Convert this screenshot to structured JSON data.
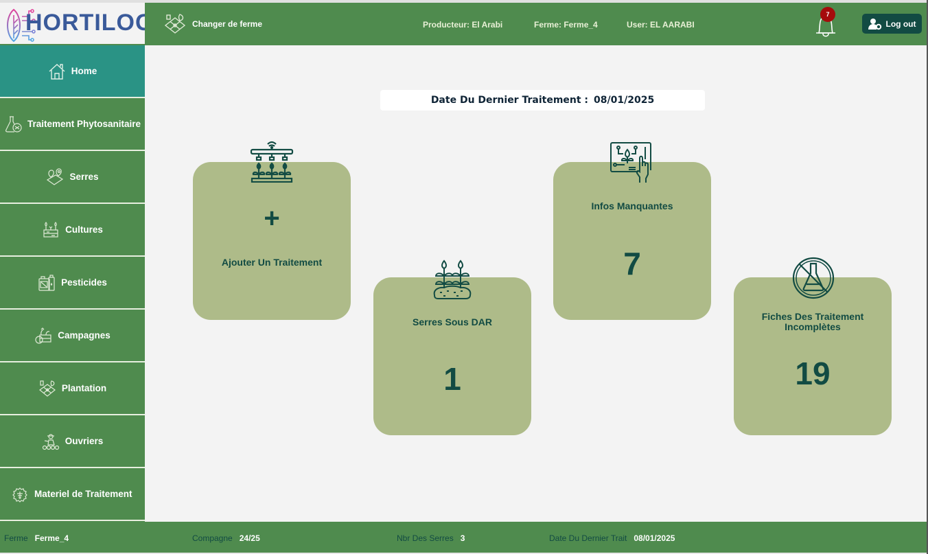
{
  "app": {
    "name": "HORTILOG"
  },
  "header": {
    "change_farm_label": "Changer de ferme",
    "producteur": "Producteur: El Arabi",
    "ferme": "Ferme: Ferme_4",
    "user": "User: EL AARABI",
    "notification_count": "7",
    "logout_label": "Log out"
  },
  "sidebar": {
    "items": [
      {
        "label": "Home",
        "icon": "home-icon",
        "active": true
      },
      {
        "label": "Traitement Phytosanitaire",
        "icon": "flask-icon"
      },
      {
        "label": "Serres",
        "icon": "map-pin-icon"
      },
      {
        "label": "Cultures",
        "icon": "crops-icon"
      },
      {
        "label": "Pesticides",
        "icon": "pesticide-icon"
      },
      {
        "label": "Campagnes",
        "icon": "harvest-basket-icon"
      },
      {
        "label": "Plantation",
        "icon": "plantation-icon"
      },
      {
        "label": "Ouvriers",
        "icon": "worker-icon"
      },
      {
        "label": "Materiel de Traitement",
        "icon": "equipment-gear-icon"
      }
    ]
  },
  "main": {
    "last_treatment_label": "Date Du Dernier Traitement :",
    "last_treatment_date": "08/01/2025",
    "cards": {
      "add": {
        "title": "Ajouter Un Traitement",
        "symbol": "+"
      },
      "serres_dar": {
        "title": "Serres Sous  DAR",
        "value": "1"
      },
      "infos": {
        "title": "Infos Manquantes",
        "value": "7"
      },
      "fiches": {
        "title": "Fiches Des Traitement Incomplètes",
        "value": "19"
      }
    }
  },
  "footer": {
    "ferme_label": "Ferme",
    "ferme_value": "Ferme_4",
    "campagne_label": "Compagne",
    "campagne_value": "24/25",
    "serres_label": "Nbr Des Serres",
    "serres_value": "3",
    "date_label": "Date Du Dernier Trait",
    "date_value": "08/01/2025"
  },
  "colors": {
    "primary_green": "#4f8b4e",
    "active_teal": "#2a9385",
    "card_bg": "#aebb89",
    "dark_teal": "#124b43",
    "badge_red": "#a50c0c",
    "logo_blue": "#3a5a9a"
  }
}
